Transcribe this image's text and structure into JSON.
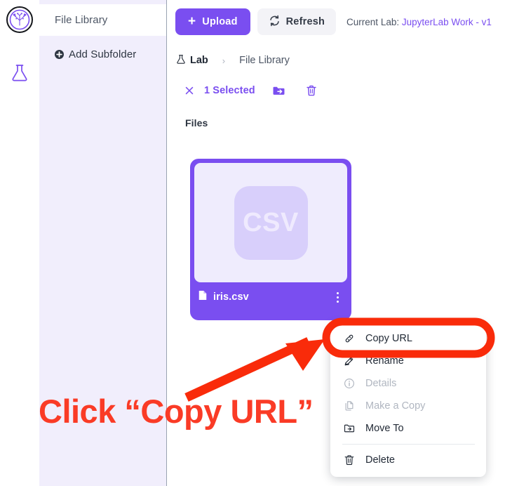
{
  "rail": {
    "logo_icon": "tree-circle-logo",
    "flask_icon": "flask-icon"
  },
  "sidebar": {
    "root_label": "File Library",
    "add_subfolder_label": "Add Subfolder",
    "add_icon": "plus-circle-icon"
  },
  "toolbar": {
    "upload_label": "Upload",
    "upload_plus": "+",
    "refresh_label": "Refresh",
    "refresh_icon": "refresh-icon",
    "current_lab_prefix": "Current Lab:",
    "current_lab_name": "JupyterLab Work - v1"
  },
  "breadcrumb": {
    "lab_label": "Lab",
    "lab_icon": "flask-icon",
    "separator": "›",
    "current_label": "File Library"
  },
  "selection_bar": {
    "close_icon": "close-icon",
    "count_label": "1 Selected",
    "move_icon": "move-to-folder-icon",
    "delete_icon": "trash-icon"
  },
  "content": {
    "section_label": "Files"
  },
  "file_card": {
    "type_badge": "CSV",
    "file_name": "iris.csv",
    "file_icon": "file-icon",
    "kebab_icon": "kebab-menu-icon"
  },
  "context_menu": {
    "items": [
      {
        "label": "Copy URL",
        "icon": "link-icon",
        "disabled": false
      },
      {
        "label": "Rename",
        "icon": "pencil-icon",
        "disabled": false
      },
      {
        "label": "Details",
        "icon": "info-circle-icon",
        "disabled": true
      },
      {
        "label": "Make a Copy",
        "icon": "copy-icon",
        "disabled": true
      },
      {
        "label": "Move To",
        "icon": "move-to-folder-icon",
        "disabled": false
      },
      {
        "label": "Delete",
        "icon": "trash-icon",
        "disabled": false
      }
    ]
  },
  "annotation": {
    "text": "Click “Copy URL”",
    "color": "#fa3b26",
    "highlight_shape": "rounded-oval-outline",
    "arrow_icon": "arrow-pointer"
  },
  "colors": {
    "accent": "#7a4ef0",
    "sidebar_bg": "#f1eefc",
    "thumb_bg": "#efecfd",
    "chip_bg": "#d8cffb",
    "annotation_red": "#fa3b26"
  }
}
